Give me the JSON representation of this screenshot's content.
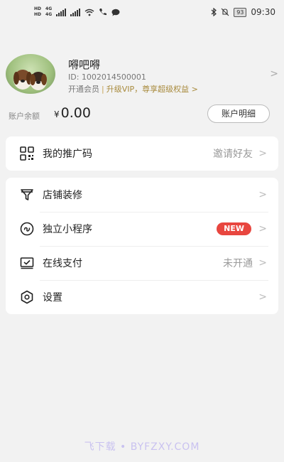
{
  "status_bar": {
    "hd_top": "HD",
    "hd_bottom": "HD",
    "net_top": "4G",
    "net_bottom": "4G",
    "battery": "93",
    "time": "09:30"
  },
  "profile": {
    "username": "嘚吧嘚",
    "user_id": "ID: 1002014500001",
    "member_label": "开通会员",
    "separator": "|",
    "vip_promo": "升级VIP，尊享超级权益",
    "vip_chevron": ">",
    "chevron": ">"
  },
  "balance": {
    "label": "账户余额",
    "currency": "¥",
    "amount": "0.00",
    "details_button": "账户明细"
  },
  "menu_primary": [
    {
      "label": "我的推广码",
      "value": "邀请好友",
      "icon": "qr-code-icon"
    }
  ],
  "menu_secondary": [
    {
      "label": "店铺装修",
      "value": "",
      "icon": "funnel-icon"
    },
    {
      "label": "独立小程序",
      "value": "",
      "badge": "NEW",
      "badge_color": "#e8463f",
      "icon": "mini-program-icon"
    },
    {
      "label": "在线支付",
      "value": "未开通",
      "icon": "payment-icon"
    },
    {
      "label": "设置",
      "value": "",
      "icon": "settings-icon"
    }
  ],
  "chevron": ">",
  "watermark": "飞下载 • BYFZXY.COM"
}
